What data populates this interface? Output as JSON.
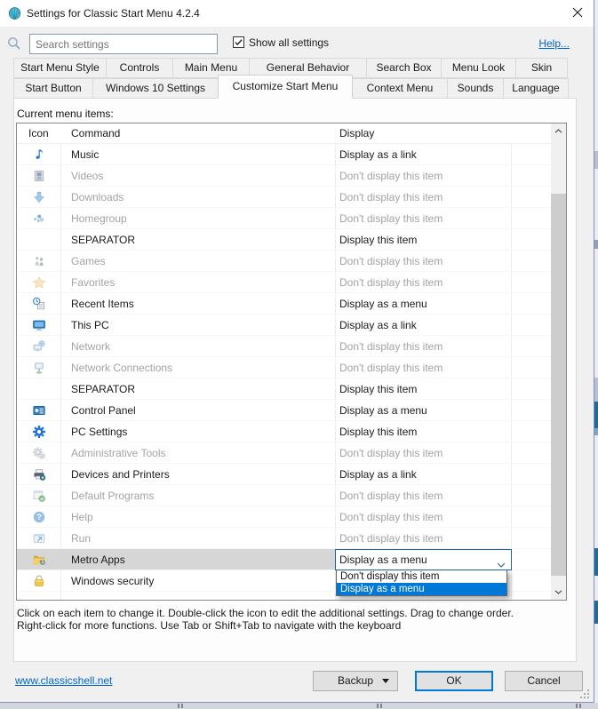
{
  "window": {
    "title": "Settings for Classic Start Menu 4.2.4"
  },
  "search": {
    "placeholder": "Search settings",
    "show_all_settings_label": "Show all settings",
    "show_all_settings_checked": true,
    "help_link": "Help..."
  },
  "tabs": {
    "active": "Customize Start Menu",
    "row1": [
      "Start Menu Style",
      "Controls",
      "Main Menu",
      "General Behavior",
      "Search Box",
      "Menu Look",
      "Skin"
    ],
    "row2": [
      "Start Button",
      "Windows 10 Settings",
      "Customize Start Menu",
      "Context Menu",
      "Sounds",
      "Language"
    ]
  },
  "page": {
    "heading": "Current menu items:",
    "table": {
      "columns": [
        "Icon",
        "Command",
        "Display"
      ],
      "rows": [
        {
          "icon": "music-icon",
          "command": "Music",
          "display": "Display as a link",
          "state": "normal"
        },
        {
          "icon": "videos-icon",
          "command": "Videos",
          "display": "Don't display this item",
          "state": "disabled"
        },
        {
          "icon": "downloads-icon",
          "command": "Downloads",
          "display": "Don't display this item",
          "state": "disabled"
        },
        {
          "icon": "homegroup-icon",
          "command": "Homegroup",
          "display": "Don't display this item",
          "state": "disabled"
        },
        {
          "icon": null,
          "command": "SEPARATOR",
          "display": "Display this item",
          "state": "normal"
        },
        {
          "icon": "games-icon",
          "command": "Games",
          "display": "Don't display this item",
          "state": "disabled"
        },
        {
          "icon": "favorites-icon",
          "command": "Favorites",
          "display": "Don't display this item",
          "state": "disabled"
        },
        {
          "icon": "recent-items-icon",
          "command": "Recent Items",
          "display": "Display as a menu",
          "state": "normal"
        },
        {
          "icon": "this-pc-icon",
          "command": "This PC",
          "display": "Display as a link",
          "state": "normal"
        },
        {
          "icon": "network-icon",
          "command": "Network",
          "display": "Don't display this item",
          "state": "disabled"
        },
        {
          "icon": "network-connections-icon",
          "command": "Network Connections",
          "display": "Don't display this item",
          "state": "disabled"
        },
        {
          "icon": null,
          "command": "SEPARATOR",
          "display": "Display this item",
          "state": "normal"
        },
        {
          "icon": "control-panel-icon",
          "command": "Control Panel",
          "display": "Display as a menu",
          "state": "normal"
        },
        {
          "icon": "pc-settings-icon",
          "command": "PC Settings",
          "display": "Display this item",
          "state": "normal"
        },
        {
          "icon": "administrative-tools-icon",
          "command": "Administrative Tools",
          "display": "Don't display this item",
          "state": "disabled"
        },
        {
          "icon": "devices-and-printers-icon",
          "command": "Devices and Printers",
          "display": "Display as a link",
          "state": "normal"
        },
        {
          "icon": "default-programs-icon",
          "command": "Default Programs",
          "display": "Don't display this item",
          "state": "disabled"
        },
        {
          "icon": "help-icon",
          "command": "Help",
          "display": "Don't display this item",
          "state": "disabled"
        },
        {
          "icon": "run-icon",
          "command": "Run",
          "display": "Don't display this item",
          "state": "disabled"
        },
        {
          "icon": "metro-apps-icon",
          "command": "Metro Apps",
          "display": "Display as a menu",
          "state": "selected",
          "combo": true
        },
        {
          "icon": "windows-security-icon",
          "command": "Windows security",
          "display": "",
          "state": "normal"
        }
      ]
    },
    "dropdown": {
      "value": "Display as a menu",
      "options": [
        "Don't display this item",
        "Display as a menu"
      ],
      "highlighted": "Display as a menu"
    },
    "instructions": [
      "Click on each item to change it. Double-click the icon to edit the additional settings. Drag to change order.",
      "Right-click for more functions. Use Tab or Shift+Tab to navigate with the keyboard"
    ]
  },
  "footer": {
    "website": "www.classicshell.net",
    "backup_label": "Backup",
    "ok_label": "OK",
    "cancel_label": "Cancel"
  },
  "colors": {
    "accent": "#0078d7",
    "selection_highlight": "#0078d7",
    "link": "#0066cc",
    "disabled_text": "#a3a3a3"
  }
}
